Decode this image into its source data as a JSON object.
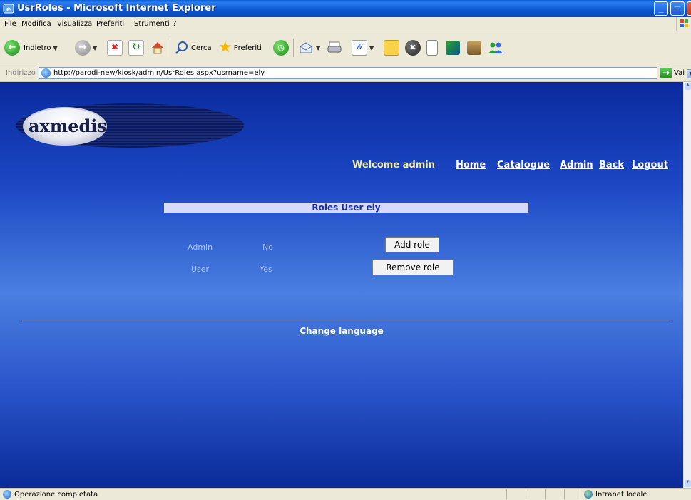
{
  "window": {
    "title": "UsrRoles - Microsoft Internet Explorer",
    "minimize": "_",
    "maximize": "□"
  },
  "menu": [
    "File",
    "Modifica",
    "Visualizza",
    "Preferiti",
    "Strumenti",
    "?"
  ],
  "toolbar": {
    "back_label": "Indietro",
    "search_label": "Cerca",
    "favorites_label": "Preferiti"
  },
  "address": {
    "label": "Indirizzo",
    "url": "http://parodi-new/kiosk/admin/UsrRoles.aspx?usrname=ely",
    "go_label": "Vai"
  },
  "page": {
    "logo_text": "axmedis",
    "welcome": "Welcome admin",
    "nav": [
      "Home",
      "Catalogue",
      "Admin",
      "Back",
      "Logout"
    ],
    "roles_title": "Roles User ely",
    "roles": [
      {
        "name": "Admin",
        "has": "No",
        "action": "Add role"
      },
      {
        "name": "User",
        "has": "Yes",
        "action": "Remove role"
      }
    ],
    "change_language": "Change language"
  },
  "status": {
    "text": "Operazione completata",
    "zone": "Intranet locale"
  },
  "colors": {
    "page_bg_top": "#0a2a9e",
    "page_bg_mid": "#4a7fe0",
    "roles_header_bg": "#d6dafd",
    "roles_header_text": "#1a2fa0",
    "welcome_text": "#f5e9a0"
  }
}
